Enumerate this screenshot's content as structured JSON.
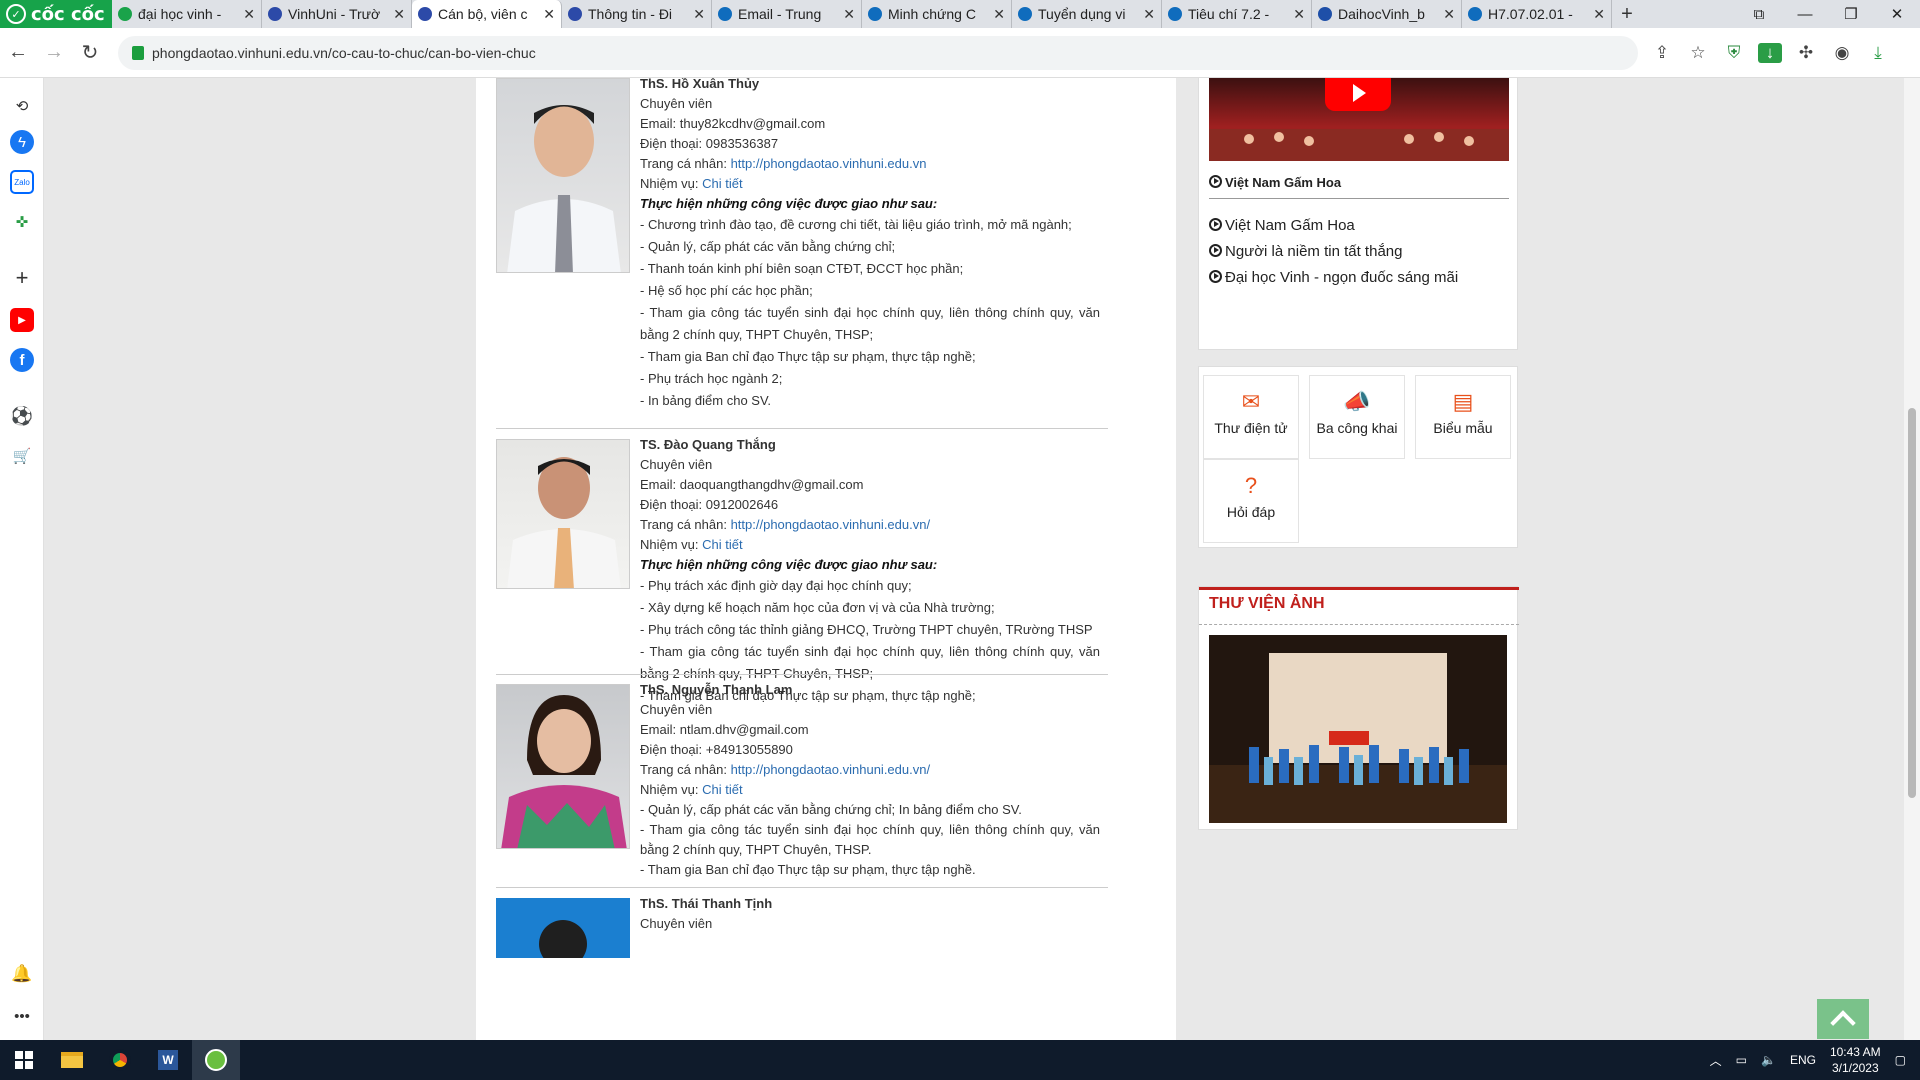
{
  "browser": {
    "brand": "cốc cốc",
    "tabs": [
      {
        "label": "đại học vinh -",
        "color": "#1aa34a"
      },
      {
        "label": "VinhUni - Trườ",
        "color": "#2c4aa8"
      },
      {
        "label": "Cán bộ, viên c",
        "color": "#2c4aa8",
        "active": true
      },
      {
        "label": "Thông tin - Đi",
        "color": "#2c4aa8"
      },
      {
        "label": "Email - Trung",
        "color": "#0f6cbd"
      },
      {
        "label": "Minh chứng C",
        "color": "#0f6cbd"
      },
      {
        "label": "Tuyển dụng vi",
        "color": "#0f6cbd"
      },
      {
        "label": "Tiêu chí 7.2 -",
        "color": "#0f6cbd"
      },
      {
        "label": "DaihocVinh_b",
        "color": "#1e4fa8"
      },
      {
        "label": "H7.07.02.01 -",
        "color": "#0f6cbd"
      }
    ],
    "url": "phongdaotao.vinhuni.edu.vn/co-cau-to-chuc/can-bo-vien-chuc"
  },
  "staff": [
    {
      "name": "ThS. Hồ Xuân Thủy",
      "role": "Chuyên viên",
      "email": "Email: thuy82kcdhv@gmail.com",
      "phone": "Điện thoại: 0983536387",
      "homepage_label": "Trang cá nhân: ",
      "homepage_link": "http://phongdaotao.vinhuni.edu.vn",
      "task_label": "Nhiệm vụ: ",
      "task_link": "Chi tiết",
      "duty_heading": "Thực hiện những công việc được giao như sau:",
      "duties": [
        "- Chương trình đào tạo, đề cương chi tiết, tài liệu giáo trình, mở mã ngành;",
        "- Quản lý, cấp phát các văn bằng chứng chỉ;",
        "- Thanh toán kinh phí biên soạn CTĐT, ĐCCT học phần;",
        "- Hệ số học phí các học phần;",
        "- Tham gia công tác tuyển sinh đại học chính quy, liên thông chính quy, văn bằng 2 chính quy, THPT Chuyên, THSP;",
        "- Tham gia Ban chỉ đạo Thực tập sư phạm, thực tập nghề;",
        "- Phụ trách học ngành 2;",
        "- In bảng điểm cho SV."
      ]
    },
    {
      "name": "TS. Đào Quang Thắng",
      "role": "Chuyên viên",
      "email": "Email: daoquangthangdhv@gmail.com",
      "phone": "Điện thoại: 0912002646",
      "homepage_label": "Trang cá nhân: ",
      "homepage_link": "http://phongdaotao.vinhuni.edu.vn/",
      "task_label": "Nhiệm vụ: ",
      "task_link": "Chi tiết",
      "duty_heading": "Thực hiện những công việc được giao như sau:",
      "duties": [
        "- Phụ trách xác định giờ dạy đại học chính quy;",
        "- Xây dựng kế hoạch năm học của đơn vị và của Nhà trường;",
        "- Phụ trách công tác thỉnh giảng ĐHCQ, Trường THPT chuyên, TRường THSP",
        "- Tham gia công tác tuyển sinh đại học chính quy, liên thông chính quy, văn bằng 2 chính quy, THPT Chuyên, THSP;",
        "- Tham gia Ban chỉ đạo Thực tập sư phạm, thực tập nghề;"
      ]
    },
    {
      "name": "ThS. Nguyễn Thanh Lam",
      "role": "Chuyên viên",
      "email": "Email: ntlam.dhv@gmail.com",
      "phone": "Điện thoại: +84913055890",
      "homepage_label": "Trang cá nhân: ",
      "homepage_link": "http://phongdaotao.vinhuni.edu.vn/",
      "task_label": "Nhiệm vụ: ",
      "task_link": "Chi tiết",
      "duties": [
        "- Quản lý, cấp phát các văn bằng chứng chỉ; In bảng điểm cho SV.",
        "- Tham gia công tác tuyển sinh đại học chính quy, liên thông chính quy, văn bằng 2 chính quy, THPT Chuyên, THSP.",
        "- Tham gia Ban chỉ đạo Thực tập sư phạm, thực tập nghề."
      ]
    },
    {
      "name": "ThS. Thái Thanh Tịnh",
      "role": "Chuyên viên"
    }
  ],
  "video": {
    "caption": "Việt Nam Gấm Hoa",
    "list": [
      "Việt Nam Gấm Hoa",
      "Người là niềm tin tất thắng",
      "Đại học Vinh - ngọn đuốc sáng mãi"
    ]
  },
  "quick_links": [
    {
      "label": "Thư điện tử",
      "icon": "mail-icon"
    },
    {
      "label": "Ba công khai",
      "icon": "megaphone-icon"
    },
    {
      "label": "Biểu mẫu",
      "icon": "document-icon"
    },
    {
      "label": "Hỏi đáp",
      "icon": "question-icon"
    }
  ],
  "gallery": {
    "title": "THƯ VIỆN ẢNH"
  },
  "taskbar": {
    "lang": "ENG",
    "time": "10:43 AM",
    "date": "3/1/2023"
  }
}
